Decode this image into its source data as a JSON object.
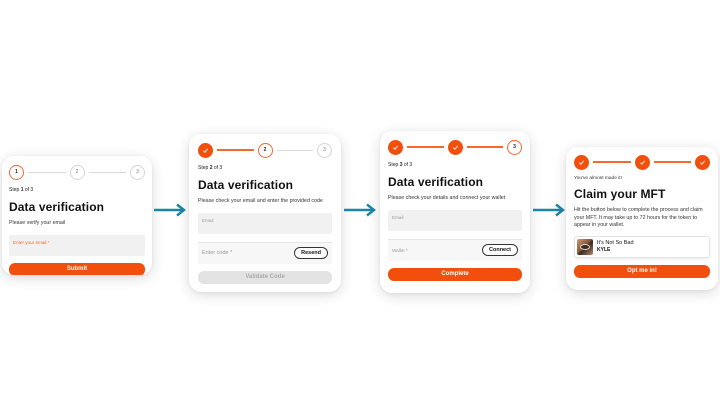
{
  "colors": {
    "accent": "#f24f0d",
    "arrow": "#1b86a6"
  },
  "card1": {
    "steps": [
      "1",
      "2",
      "3"
    ],
    "step_prefix": "Step ",
    "step_current": "1",
    "step_suffix": " of 3",
    "title": "Data verification",
    "description": "Please verify your email",
    "email_placeholder": "Enter your email *",
    "submit_label": "Submit"
  },
  "card2": {
    "steps": [
      "",
      "2",
      "3"
    ],
    "step_prefix": "Step ",
    "step_current": "2",
    "step_suffix": " of 3",
    "title": "Data verification",
    "description": "Please check your email and enter the provided code",
    "email_placeholder": "Email",
    "code_placeholder": "Enter code *",
    "resend_label": "Resend",
    "validate_label": "Validate Code"
  },
  "card3": {
    "steps": [
      "",
      "",
      "3"
    ],
    "step_prefix": "Step ",
    "step_current": "3",
    "step_suffix": " of 3",
    "title": "Data verification",
    "description": "Please check your details and connect your wallet",
    "email_placeholder": "Email",
    "wallet_placeholder": "Wallet *",
    "connect_label": "Connect",
    "complete_label": "Complete"
  },
  "card4": {
    "almost": "You've almost made it!",
    "title": "Claim your MFT",
    "description": "Hit the button below to complete the process and claim your MFT. It may take up to 72 hours for the token to appear in your wallet.",
    "nft_name": "It's Not So Bad",
    "nft_artist": "KYLE",
    "optin_label": "Opt me in!"
  }
}
